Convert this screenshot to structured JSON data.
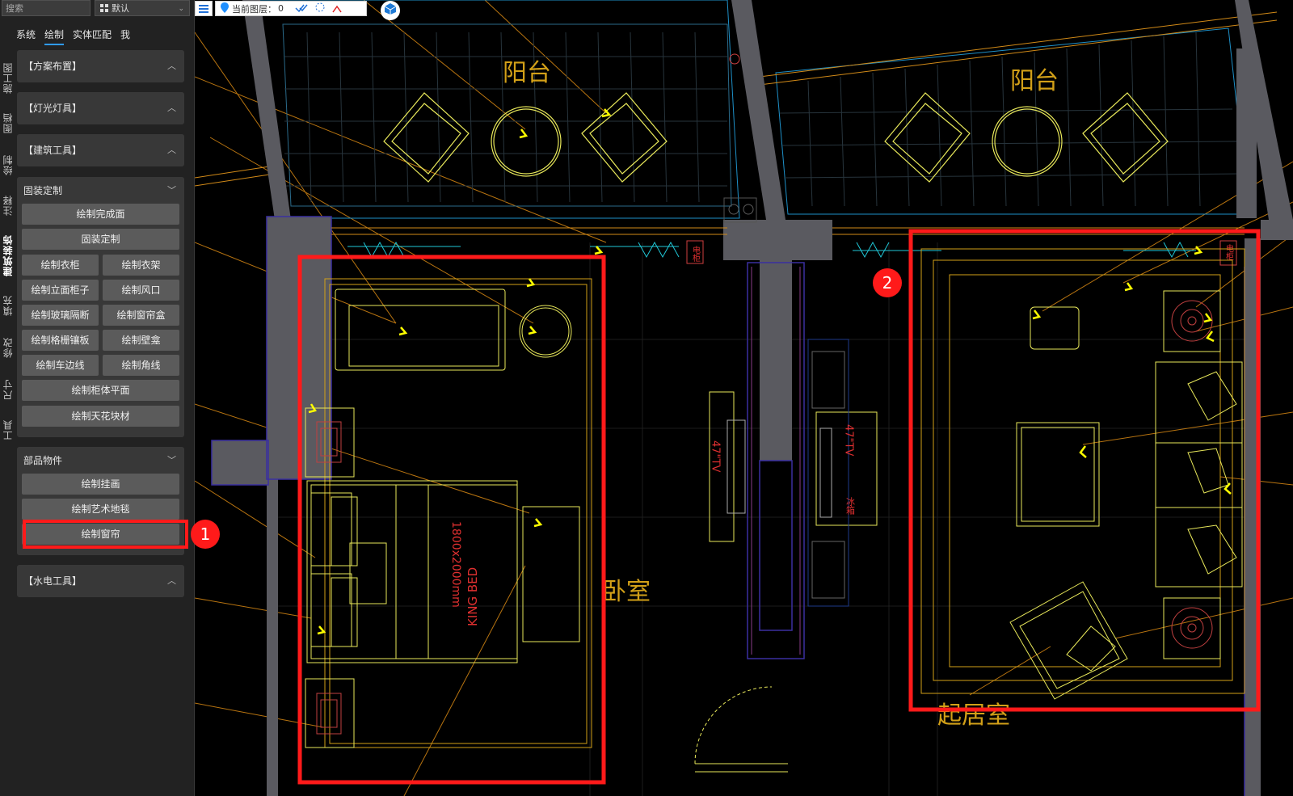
{
  "sidebar": {
    "search_placeholder": "搜索",
    "scheme_label": "默认",
    "tabs": [
      "系统",
      "绘制",
      "实体匹配",
      "我"
    ],
    "vertical_tabs": [
      "施工图",
      "图档",
      "绘制",
      "注释",
      "建筑装饰",
      "填充",
      "修改",
      "尺寸",
      "工具"
    ],
    "sections": {
      "scheme_layout": "【方案布置】",
      "lighting": "【灯光灯具】",
      "architecture": "【建筑工具】",
      "fixed_custom": {
        "title": "固装定制",
        "buttons": [
          "绘制完成面",
          "固装定制",
          "绘制衣柜",
          "绘制衣架",
          "绘制立面柜子",
          "绘制风口",
          "绘制玻璃隔断",
          "绘制窗帘盒",
          "绘制格栅镶板",
          "绘制壁龛",
          "绘制车边线",
          "绘制角线",
          "绘制柜体平面",
          "绘制天花块材"
        ]
      },
      "components": {
        "title": "部品物件",
        "buttons": [
          "绘制挂画",
          "绘制艺术地毯",
          "绘制窗帘"
        ]
      },
      "mep": "【水电工具】"
    }
  },
  "toolbar": {
    "layer_label": "当前图层：",
    "layer_value": "0"
  },
  "annotations": {
    "badge1": "1",
    "badge2": "2"
  },
  "drawing": {
    "balcony_left": "阳台",
    "balcony_right": "阳台",
    "bedroom": "卧室",
    "living_room": "起居室",
    "bed_label": "KING BED",
    "bed_size": "1800x2000mm",
    "tv_left": "47\"TV",
    "tv_right": "47\"TV",
    "fridge": "冰箱",
    "cabinet_left": "电柜",
    "cabinet_right": "电柜"
  },
  "colors": {
    "highlight": "#ff1a1a",
    "accent": "#2f9bff",
    "cad_yellow": "#e8e85a",
    "cad_orange": "#d28a18"
  }
}
